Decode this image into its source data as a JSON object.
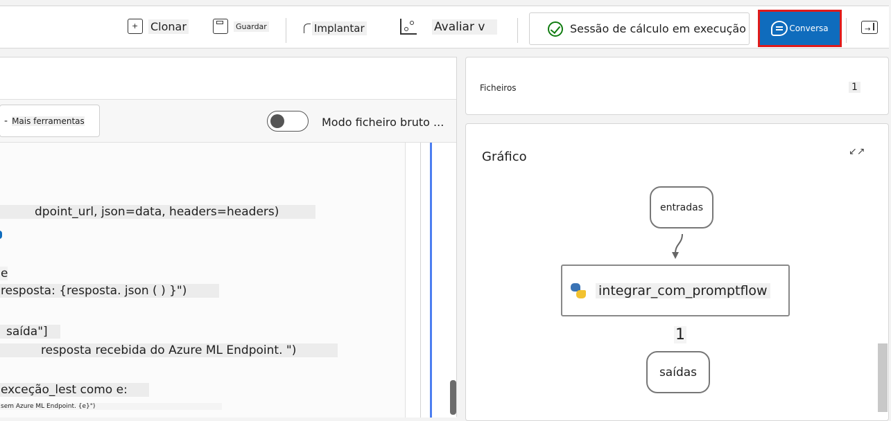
{
  "toolbar": {
    "clone_label": "Clonar",
    "save_label": "Guardar",
    "deploy_label": "Implantar",
    "evaluate_label": "Avaliar v",
    "session_status": "Sessão de cálculo em execução",
    "chat_label": "Conversa"
  },
  "editor": {
    "more_tools_prefix": "-",
    "more_tools_label": "Mais ferramentas",
    "raw_mode_label": "Modo ficheiro bruto ...",
    "lines": [
      "dpoint_url, json=data, headers=headers)",
      "e",
      "resposta: {resposta. json ( ) }\")",
      "saída\"]",
      "resposta recebida do Azure ML Endpoint. \")",
      "exceção_lest como e:",
      "sem Azure ML Endpoint. {e}\")"
    ]
  },
  "files": {
    "label": "Ficheiros",
    "count": "1"
  },
  "graph": {
    "title": "Gráfico",
    "input_node": "entradas",
    "main_node": "integrar_com_promptflow",
    "edge_label": "1",
    "output_node": "saídas"
  },
  "colors": {
    "accent": "#0f6cbd",
    "highlight_border": "#e01b1b",
    "success": "#107c10"
  }
}
